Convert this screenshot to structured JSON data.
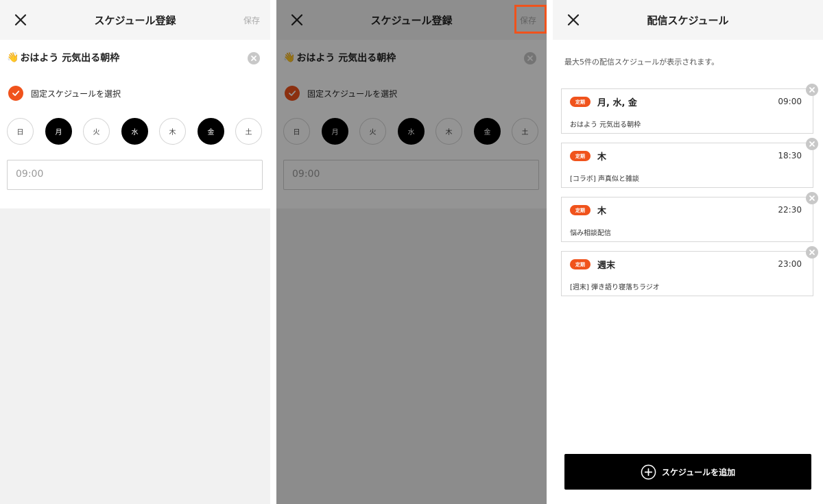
{
  "screen_register": {
    "title": "スケジュール登録",
    "save_label": "保存",
    "schedule_title": "おはよう 元気出る朝枠",
    "schedule_title_icons": [
      "waving-hand-icon",
      "sun-icon"
    ],
    "fixed_label": "固定スケジュールを選択",
    "fixed_checked": true,
    "days": [
      {
        "label": "日",
        "selected": false
      },
      {
        "label": "月",
        "selected": true
      },
      {
        "label": "火",
        "selected": false
      },
      {
        "label": "水",
        "selected": true
      },
      {
        "label": "木",
        "selected": false
      },
      {
        "label": "金",
        "selected": true
      },
      {
        "label": "土",
        "selected": false
      }
    ],
    "time_value": "09:00"
  },
  "screen_list": {
    "title": "配信スケジュール",
    "description": "最大5件の配信スケジュールが表示されます。",
    "badge_label": "定期",
    "items": [
      {
        "days": "月, 水, 金",
        "time": "09:00",
        "text": "おはよう 元気出る朝枠"
      },
      {
        "days": "木",
        "time": "18:30",
        "text": "[コラボ] 声真似と雑談"
      },
      {
        "days": "木",
        "time": "22:30",
        "text": "悩み相談配信"
      },
      {
        "days": "週末",
        "time": "23:00",
        "text": "[週末] 弾き語り寝落ちラジオ"
      }
    ],
    "add_label": "スケジュールを追加"
  },
  "colors": {
    "accent": "#f0531c",
    "overlay": "rgba(0,0,0,0.42)",
    "day_selected": "#000000"
  }
}
